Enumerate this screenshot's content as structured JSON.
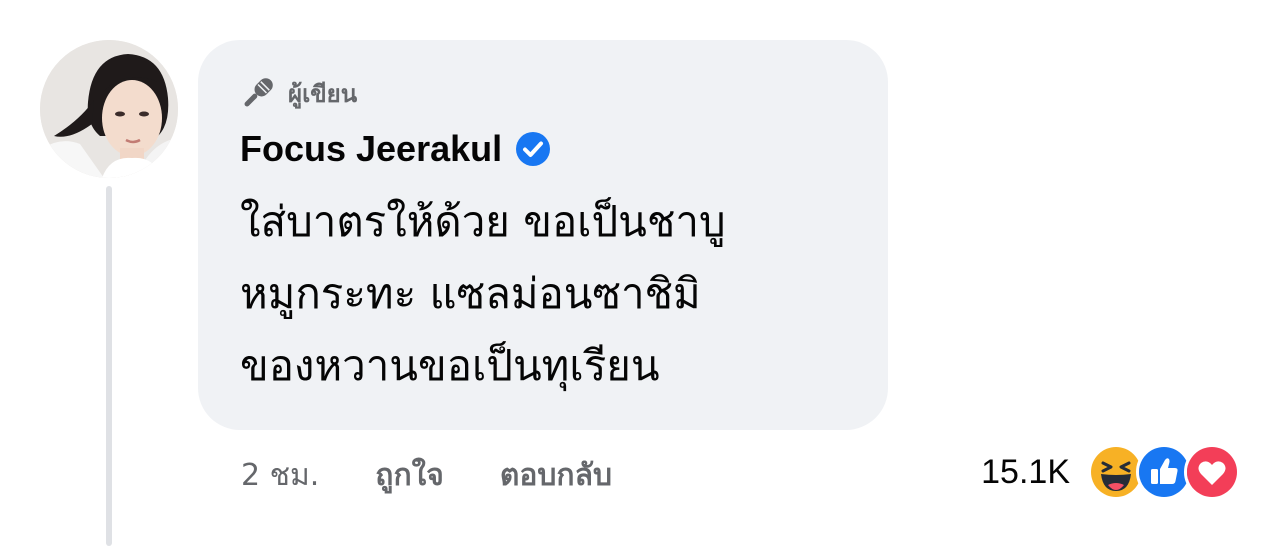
{
  "comment": {
    "author_badge": "ผู้เขียน",
    "author_name": "Focus Jeerakul",
    "verified": true,
    "text_lines": [
      "ใส่บาตรให้ด้วย ขอเป็นชาบู",
      "หมูกระทะ แซลม่อนซาชิมิ",
      "ของหวานขอเป็นทุเรียน"
    ],
    "timestamp": "2 ชม.",
    "actions": {
      "like_label": "ถูกใจ",
      "reply_label": "ตอบกลับ"
    },
    "reactions": {
      "count": "15.1K",
      "icons": [
        "laugh-reaction-icon",
        "like-reaction-icon",
        "love-reaction-icon"
      ]
    }
  },
  "colors": {
    "bubble_bg": "#f0f2f5",
    "secondary_text": "#65676b",
    "verified_blue": "#1877f2",
    "haha_yellow": "#f7b125",
    "like_blue": "#1877f2",
    "love_red": "#f33e58"
  }
}
